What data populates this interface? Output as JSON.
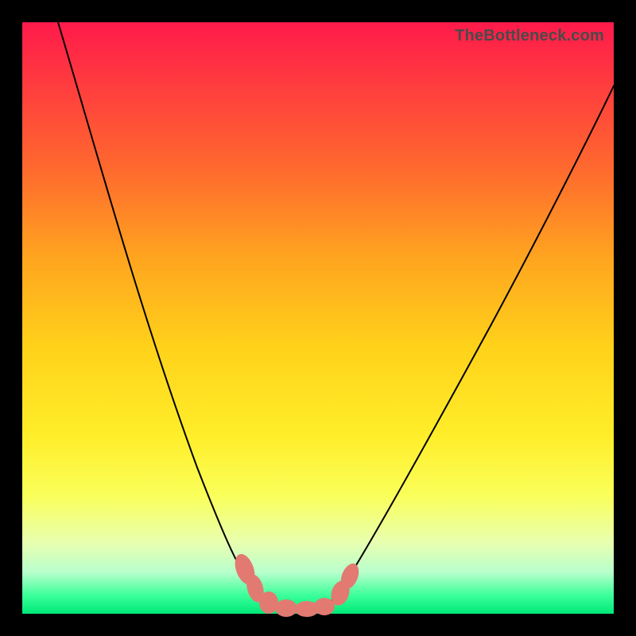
{
  "watermark": {
    "text": "TheBottleneck.com"
  },
  "chart_data": {
    "type": "line",
    "title": "",
    "xlabel": "",
    "ylabel": "",
    "xlim": [
      0,
      100
    ],
    "ylim": [
      0,
      100
    ],
    "grid": false,
    "legend": false,
    "background_gradient": {
      "top_color": "#ff1a4b",
      "bottom_color": "#00e878",
      "meaning": "value gradient red-high to green-low"
    },
    "series": [
      {
        "name": "bottleneck-curve",
        "style": "black-line",
        "x": [
          6,
          10,
          14,
          18,
          22,
          26,
          30,
          34,
          36,
          38,
          40,
          42,
          44,
          46,
          48,
          50,
          52,
          56,
          60,
          66,
          72,
          80,
          90,
          100
        ],
        "values": [
          100,
          90,
          80,
          70,
          60,
          48,
          36,
          24,
          18,
          12,
          7,
          3,
          1,
          0,
          0,
          0,
          1,
          3,
          8,
          17,
          28,
          42,
          60,
          78
        ]
      }
    ],
    "markers": [
      {
        "name": "optimal-zone",
        "style": "pink-blob",
        "x_range": [
          36,
          52
        ],
        "y_mean": 2
      }
    ],
    "notes": "V-shaped curve with flat minimum near x≈44–50; pink rounded markers cluster at and around the minimum."
  }
}
